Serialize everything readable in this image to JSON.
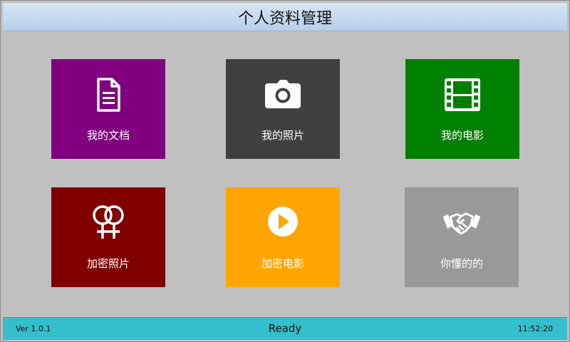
{
  "window": {
    "title": "个人资料管理"
  },
  "tiles": [
    {
      "label": "我的文档",
      "icon": "document-icon",
      "color": "#800080"
    },
    {
      "label": "我的照片",
      "icon": "camera-icon",
      "color": "#404040"
    },
    {
      "label": "我的电影",
      "icon": "film-icon",
      "color": "#008000"
    },
    {
      "label": "加密照片",
      "icon": "linked-rings-icon",
      "color": "#800000"
    },
    {
      "label": "加密电影",
      "icon": "play-icon",
      "color": "#ffa500"
    },
    {
      "label": "你懂的的",
      "icon": "handshake-icon",
      "color": "#999999"
    }
  ],
  "statusbar": {
    "version": "Ver 1.0.1",
    "status": "Ready",
    "clock": "11:52:20",
    "color": "#35bfcc"
  }
}
